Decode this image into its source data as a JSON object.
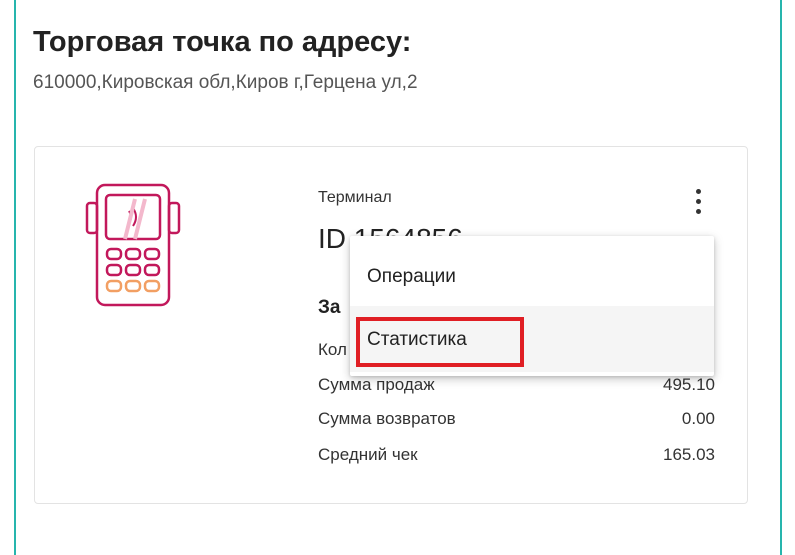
{
  "outlet": {
    "title": "Торговая точка по адресу:",
    "address": "610000,Кировская обл,Киров г,Герцена ул,2"
  },
  "terminal": {
    "type_label": "Терминал",
    "id_label": "ID 1564856",
    "menu_icon": "more-vertical-icon",
    "illustration_icon": "pos-terminal-icon",
    "accent_color": "#c2185b"
  },
  "stats": {
    "heading": "За",
    "rows": [
      {
        "label": "Кол",
        "value": ""
      },
      {
        "label": "Сумма продаж",
        "value": "495.10"
      },
      {
        "label": "Сумма возвратов",
        "value": "0.00"
      },
      {
        "label": "Средний чек",
        "value": "165.03"
      }
    ]
  },
  "menu": {
    "items": [
      {
        "label": "Операции"
      },
      {
        "label": "Статистика"
      }
    ],
    "highlight_color": "#e01e24"
  }
}
